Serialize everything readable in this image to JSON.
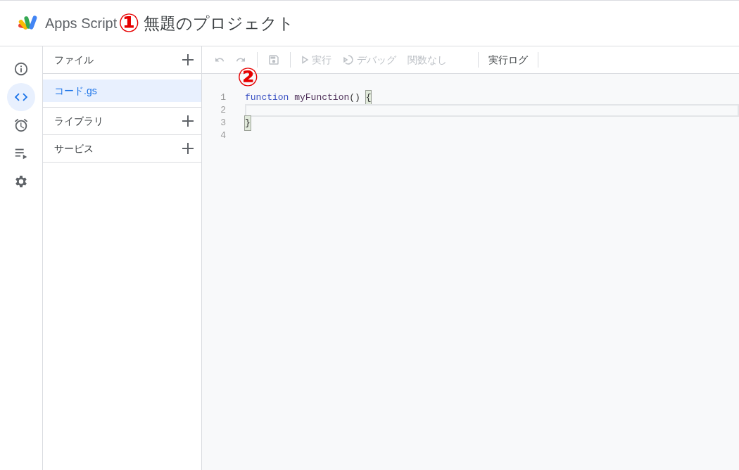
{
  "header": {
    "product": "Apps Script",
    "annotation": "①",
    "project_title": "無題のプロジェクト"
  },
  "rail": [
    {
      "kind": "info",
      "selected": false
    },
    {
      "kind": "code",
      "selected": true
    },
    {
      "kind": "alarm",
      "selected": false
    },
    {
      "kind": "executions",
      "selected": false
    },
    {
      "kind": "settings",
      "selected": false
    }
  ],
  "sections": [
    {
      "title": "ファイル",
      "items": [
        {
          "label": "コード.gs",
          "selected": true
        }
      ]
    },
    {
      "title": "ライブラリ"
    },
    {
      "title": "サービス"
    }
  ],
  "toolbar": [
    {
      "kind": "undo",
      "disabled": true
    },
    {
      "kind": "redo",
      "disabled": true
    },
    {
      "kind": "divider"
    },
    {
      "kind": "save",
      "disabled": true
    },
    {
      "kind": "divider"
    },
    {
      "kind": "run",
      "label": "実行",
      "disabled": true
    },
    {
      "kind": "debug",
      "label": "デバッグ",
      "disabled": true
    },
    {
      "kind": "select",
      "label": "関数なし",
      "disabled": true
    },
    {
      "kind": "divider"
    },
    {
      "kind": "text",
      "label": "実行ログ",
      "disabled": false
    },
    {
      "kind": "divider"
    }
  ],
  "editor": {
    "annotation": "②",
    "lines": [
      {
        "number": "1",
        "active": false,
        "tokens": [
          {
            "text": "function ",
            "kind": "keyword"
          },
          {
            "text": "myFunction",
            "kind": "name"
          },
          {
            "text": "() ",
            "kind": "plain"
          },
          {
            "text": "{",
            "kind": "bracket-match"
          }
        ]
      },
      {
        "number": "2",
        "active": true
      },
      {
        "number": "3",
        "active": false,
        "tokens": [
          {
            "text": "}",
            "kind": "bracket-match"
          }
        ]
      },
      {
        "number": "4",
        "active": false
      }
    ]
  }
}
